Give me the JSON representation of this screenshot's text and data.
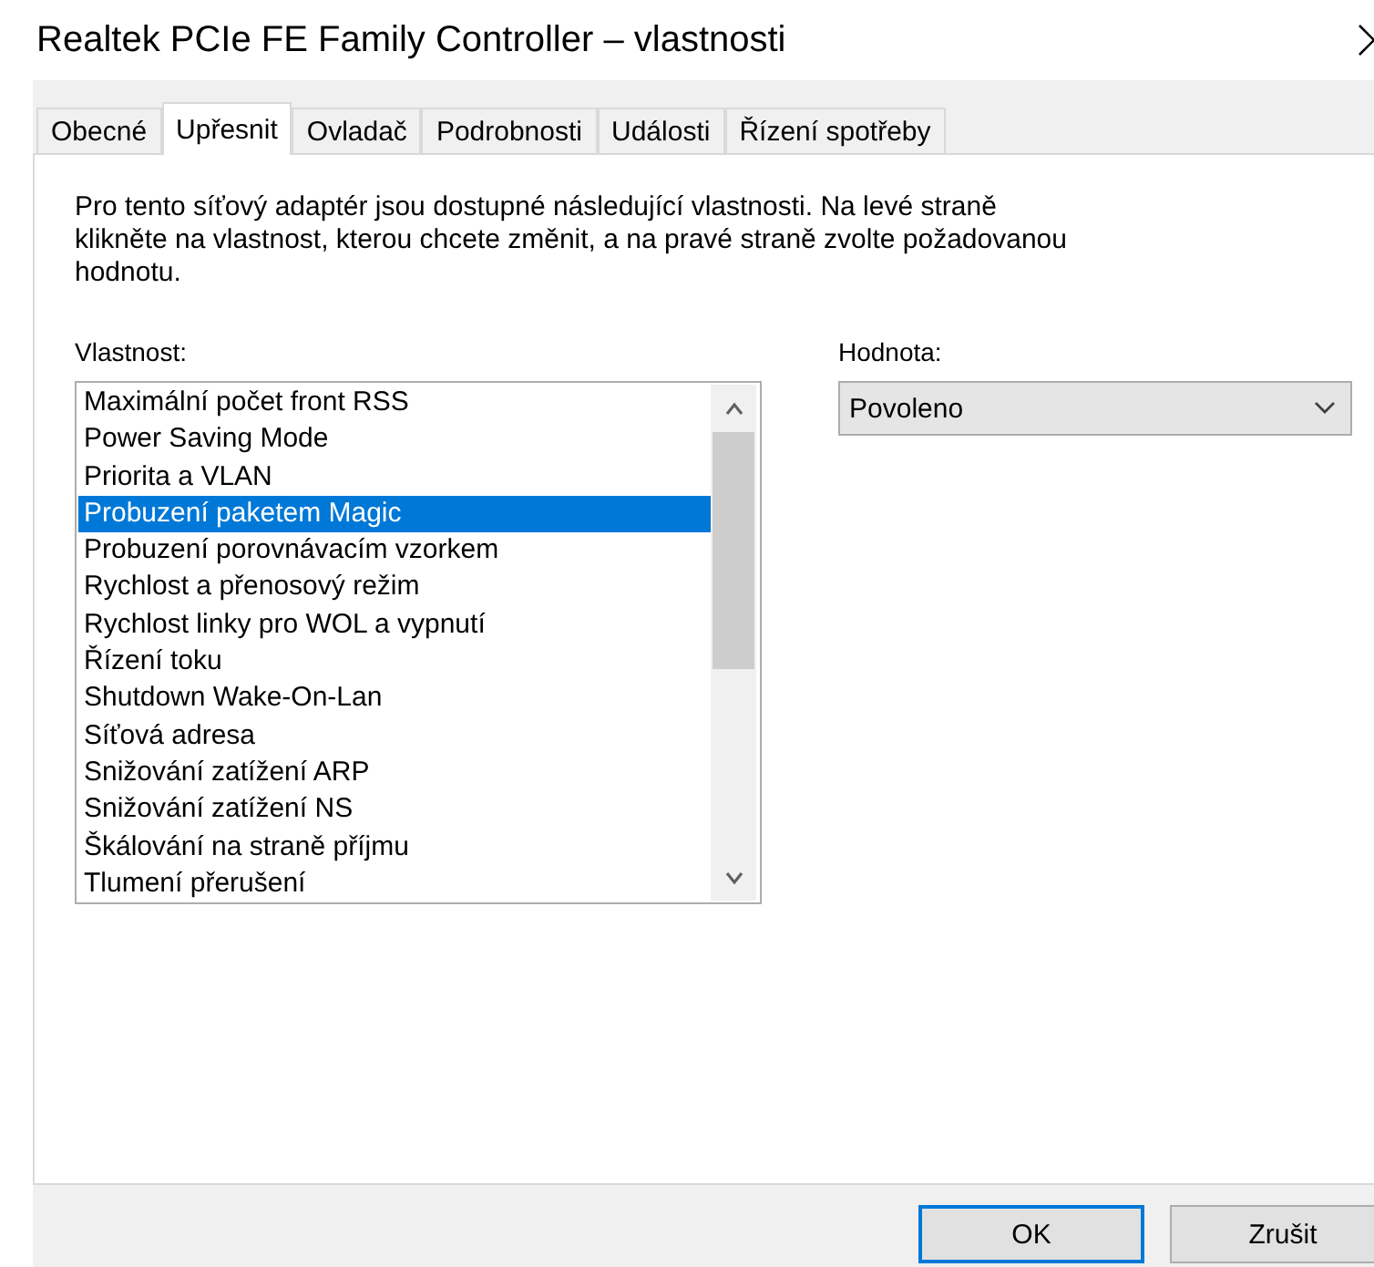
{
  "window": {
    "title": "Realtek PCIe FE Family Controller – vlastnosti"
  },
  "tabs": [
    {
      "label": "Obecné",
      "selected": false
    },
    {
      "label": "Upřesnit",
      "selected": true
    },
    {
      "label": "Ovladač",
      "selected": false
    },
    {
      "label": "Podrobnosti",
      "selected": false
    },
    {
      "label": "Události",
      "selected": false
    },
    {
      "label": "Řízení spotřeby",
      "selected": false
    }
  ],
  "description": "Pro tento síťový adaptér jsou dostupné následující vlastnosti. Na levé straně klikněte na vlastnost, kterou chcete změnit, a na pravé straně zvolte požadovanou hodnotu.",
  "property": {
    "label": "Vlastnost:",
    "items": [
      {
        "label": "Maximální počet front RSS",
        "selected": false
      },
      {
        "label": "Power Saving Mode",
        "selected": false
      },
      {
        "label": "Priorita a VLAN",
        "selected": false
      },
      {
        "label": "Probuzení paketem Magic",
        "selected": true
      },
      {
        "label": "Probuzení porovnávacím vzorkem",
        "selected": false
      },
      {
        "label": "Rychlost a přenosový režim",
        "selected": false
      },
      {
        "label": "Rychlost linky pro WOL a vypnutí",
        "selected": false
      },
      {
        "label": "Řízení toku",
        "selected": false
      },
      {
        "label": "Shutdown Wake-On-Lan",
        "selected": false
      },
      {
        "label": "Síťová adresa",
        "selected": false
      },
      {
        "label": "Snižování zatížení ARP",
        "selected": false
      },
      {
        "label": "Snižování zatížení NS",
        "selected": false
      },
      {
        "label": "Škálování na straně příjmu",
        "selected": false
      },
      {
        "label": "Tlumení přerušení",
        "selected": false
      }
    ]
  },
  "value": {
    "label": "Hodnota:",
    "selected_value": "Povoleno"
  },
  "buttons": [
    {
      "label": "OK",
      "default": true
    },
    {
      "label": "Zrušit",
      "default": false
    }
  ]
}
